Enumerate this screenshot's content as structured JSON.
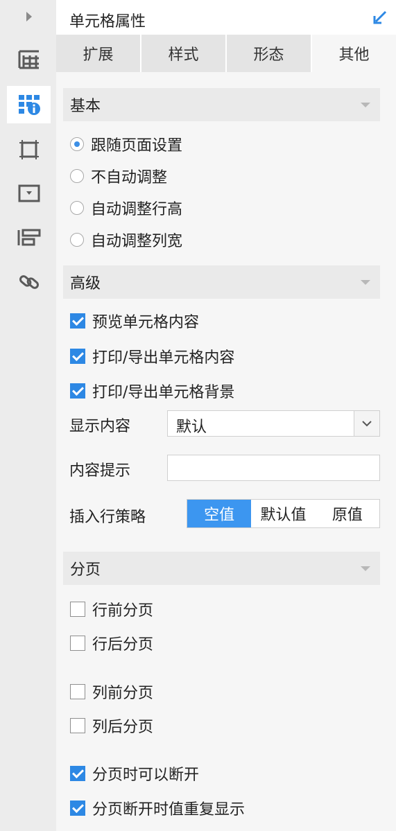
{
  "rail": {
    "items": [
      {
        "icon": "expand-arrow-icon"
      },
      {
        "icon": "table-layout-icon"
      },
      {
        "icon": "cell-attribute-icon",
        "active": true
      },
      {
        "icon": "frame-icon"
      },
      {
        "icon": "widget-icon"
      },
      {
        "icon": "align-icon"
      },
      {
        "icon": "link-icon"
      }
    ]
  },
  "header": {
    "title": "单元格属性",
    "corner_icon": "collapse-arrow-icon"
  },
  "tabs": [
    "扩展",
    "样式",
    "形态",
    "其他"
  ],
  "active_tab": "其他",
  "basic": {
    "title": "基本",
    "options": [
      {
        "label": "跟随页面设置",
        "selected": true
      },
      {
        "label": "不自动调整",
        "selected": false
      },
      {
        "label": "自动调整行高",
        "selected": false
      },
      {
        "label": "自动调整列宽",
        "selected": false
      }
    ]
  },
  "advanced": {
    "title": "高级",
    "checks": [
      {
        "label": "预览单元格内容",
        "checked": true
      },
      {
        "label": "打印/导出单元格内容",
        "checked": true
      },
      {
        "label": "打印/导出单元格背景",
        "checked": true
      }
    ],
    "display_label": "显示内容",
    "display_value": "默认",
    "tooltip_label": "内容提示",
    "tooltip_value": "",
    "insert_label": "插入行策略",
    "insert_options": [
      "空值",
      "默认值",
      "原值"
    ],
    "insert_selected": "空值"
  },
  "paging": {
    "title": "分页",
    "checks": [
      {
        "label": "行前分页",
        "checked": false
      },
      {
        "label": "行后分页",
        "checked": false
      },
      {
        "label": "列前分页",
        "checked": false
      },
      {
        "label": "列后分页",
        "checked": false
      },
      {
        "label": "分页时可以断开",
        "checked": true
      },
      {
        "label": "分页断开时值重复显示",
        "checked": true
      }
    ]
  },
  "colors": {
    "accent": "#3c96f0",
    "check": "#2d88e4"
  }
}
